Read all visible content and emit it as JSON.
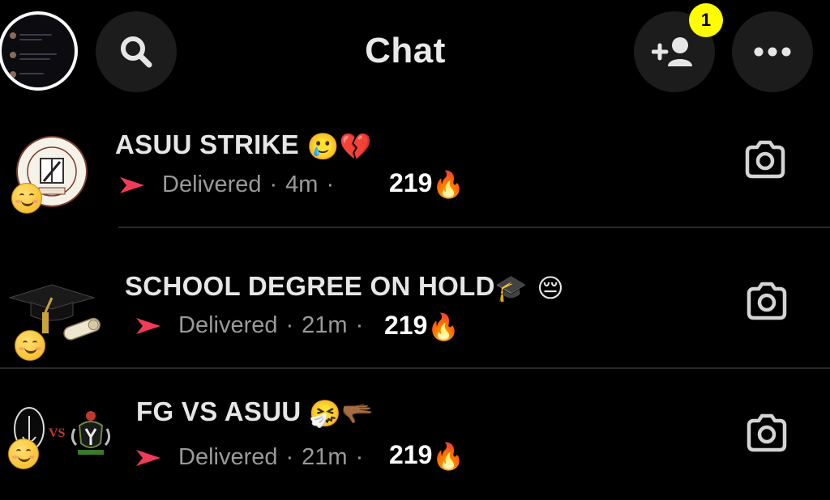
{
  "header": {
    "title": "Chat",
    "notification_count": "1",
    "icons": [
      "profile-avatar",
      "search-icon",
      "add-friend-icon",
      "more-icon"
    ]
  },
  "chats": [
    {
      "name": "ASUU STRIKE",
      "emojis": "🥲💔",
      "status": "Delivered",
      "time": "4m",
      "streak": "219",
      "streak_emoji": "🔥",
      "avatar_emoji": "😊"
    },
    {
      "name": "SCHOOL DEGREE ON HOLD",
      "emojis": "🎓 😔",
      "status": "Delivered",
      "time": "21m",
      "streak": "219",
      "streak_emoji": "🔥",
      "avatar_emoji": "😊"
    },
    {
      "name": "FG VS ASUU",
      "emojis": "🤧🫳🏾",
      "status": "Delivered",
      "time": "21m",
      "streak": "219",
      "streak_emoji": "🔥",
      "avatar_emoji": "😊",
      "avatar_text": "VS"
    }
  ],
  "colors": {
    "background": "#000000",
    "badge": "#fffc00",
    "delivered_arrow": "#f23c57",
    "button_bg": "#1c1c1c"
  }
}
